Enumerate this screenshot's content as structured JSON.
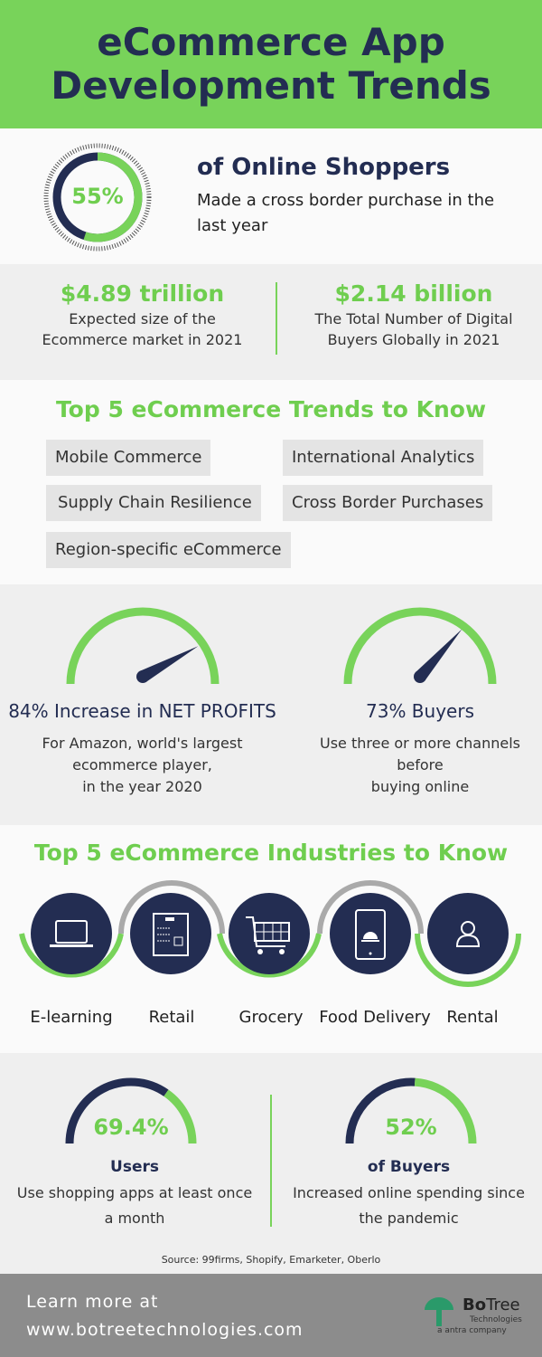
{
  "colors": {
    "green": "#78d35a",
    "navy": "#232d52",
    "light_gray": "#efefef",
    "footer_gray": "#8c8c8c"
  },
  "header": {
    "title_line1": "eCommerce App",
    "title_line2": "Development Trends"
  },
  "shoppers": {
    "percent": "55%",
    "percent_value": 55,
    "heading": "of Online Shoppers",
    "text": "Made a cross border purchase in the last year"
  },
  "stats": [
    {
      "value": "$4.89 trillion",
      "line1": "Expected size of the",
      "line2": "Ecommerce market in 2021"
    },
    {
      "value": "$2.14 billion",
      "line1": "The Total Number of Digital",
      "line2": "Buyers Globally in 2021"
    }
  ],
  "trends": {
    "title": "Top 5 eCommerce Trends to Know",
    "items": [
      "Mobile Commerce",
      "International Analytics",
      "Supply Chain Resilience",
      "Cross Border Purchases",
      "Region-specific eCommerce"
    ]
  },
  "gauges": [
    {
      "value": 84,
      "heading": "84% Increase in NET PROFITS",
      "line1": "For Amazon, world's largest",
      "line2": "ecommerce player,",
      "line3": "in the year 2020"
    },
    {
      "value": 73,
      "heading": "73% Buyers",
      "line1": "Use three or more channels",
      "line2": "before",
      "line3": "buying online"
    }
  ],
  "industries": {
    "title": "Top 5 eCommerce Industries to Know",
    "items": [
      {
        "label": "E-learning",
        "icon": "laptop-icon"
      },
      {
        "label": "Retail",
        "icon": "vending-machine-icon"
      },
      {
        "label": "Grocery",
        "icon": "shopping-cart-icon"
      },
      {
        "label": "Food Delivery",
        "icon": "phone-food-icon"
      },
      {
        "label": "Rental",
        "icon": "user-icon"
      }
    ]
  },
  "usage": [
    {
      "percent": "69.4%",
      "value": 69.4,
      "heading": "Users",
      "line1": "Use shopping apps at least once",
      "line2": "a month"
    },
    {
      "percent": "52%",
      "value": 52,
      "heading": "of Buyers",
      "line1": "Increased online spending since",
      "line2": "the pandemic"
    }
  ],
  "source": "Source: 99firms, Shopify, Emarketer, Oberlo",
  "footer": {
    "line1": "Learn more at",
    "line2": "www.botreetechnologies.com",
    "logo_name_bold": "Bo",
    "logo_name_rest": "Tree",
    "logo_sub": "Technologies",
    "logo_tag": "a antra company"
  }
}
